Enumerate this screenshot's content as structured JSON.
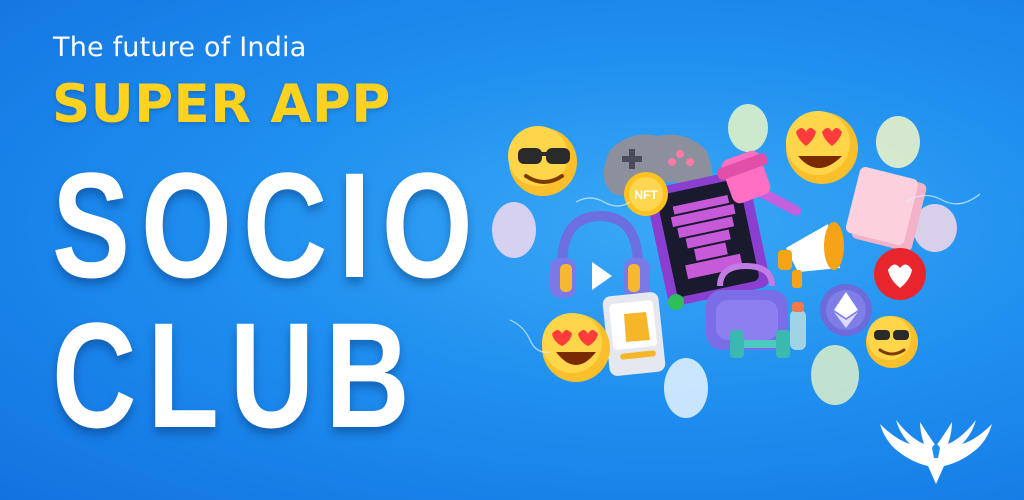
{
  "headline": {
    "tagline": "The future of India",
    "subtitle": "SUPER APP",
    "brand_line1": "SOCIO",
    "brand_line2": "CLUB"
  },
  "illustration": {
    "nft_badge": "NFT",
    "icons": [
      "sunglasses-emoji",
      "heart-eyes-emoji",
      "game-controller",
      "nft-card",
      "gavel",
      "book",
      "headphones",
      "megaphone",
      "heart-badge",
      "shopping-bag",
      "ethereum-coin",
      "dumbbell",
      "phone-shop"
    ]
  },
  "colors": {
    "background": "#1f8ff0",
    "headline_yellow": "#ffd21f",
    "text_white": "#ffffff"
  }
}
